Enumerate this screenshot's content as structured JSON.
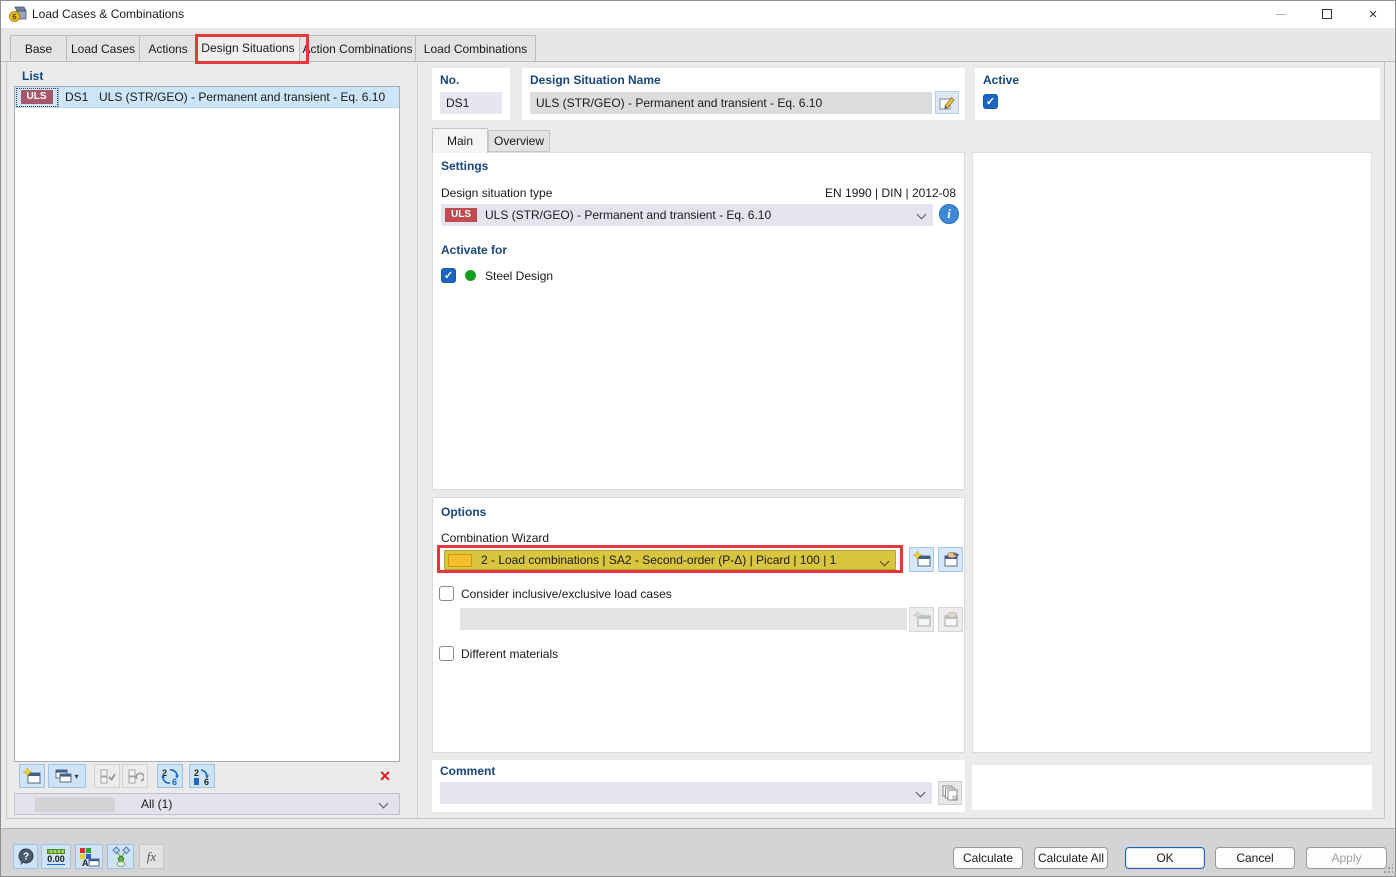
{
  "window": {
    "title": "Load Cases & Combinations"
  },
  "tabs": [
    "Base",
    "Load Cases",
    "Actions",
    "Design Situations",
    "Action Combinations",
    "Load Combinations"
  ],
  "list": {
    "header": "List",
    "row": {
      "badge": "ULS",
      "no": "DS1",
      "name": "ULS (STR/GEO) - Permanent and transient - Eq. 6.10"
    },
    "filter": "All (1)"
  },
  "detail": {
    "no_label": "No.",
    "no_value": "DS1",
    "name_label": "Design Situation Name",
    "name_value": "ULS (STR/GEO) - Permanent and transient - Eq. 6.10",
    "active_label": "Active",
    "subtabs": [
      "Main",
      "Overview"
    ],
    "settings_header": "Settings",
    "type_label": "Design situation type",
    "standard": "EN 1990 | DIN | 2012-08",
    "type_badge": "ULS",
    "type_value": "ULS (STR/GEO) - Permanent and transient - Eq. 6.10",
    "activate_header": "Activate for",
    "activate_item": "Steel Design",
    "options_header": "Options",
    "wizard_label": "Combination Wizard",
    "wizard_value": "2 - Load combinations | SA2 - Second-order (P-Δ) | Picard | 100 | 1",
    "inclusive_label": "Consider inclusive/exclusive load cases",
    "materials_label": "Different materials",
    "comment_header": "Comment",
    "comment_value": ""
  },
  "buttons": {
    "calculate": "Calculate",
    "calculate_all": "Calculate All",
    "ok": "OK",
    "cancel": "Cancel",
    "apply": "Apply"
  },
  "icons": {
    "close": "×",
    "delete": "×",
    "check": "✓",
    "help": "?",
    "info": "i",
    "fx": "fx",
    "units": "0.00",
    "copy_caret": "▾"
  },
  "colors": {
    "annotation_red": "#E23A3A",
    "wizard_yellow": "#D9C63E",
    "uls_badge_list": "#A8576B",
    "uls_badge_dropdown": "#C24B52",
    "selected_row_blue": "#CDE5F9",
    "checkbox_blue": "#1A66C2",
    "status_green": "#14A01F",
    "header_blue": "#17457E"
  }
}
